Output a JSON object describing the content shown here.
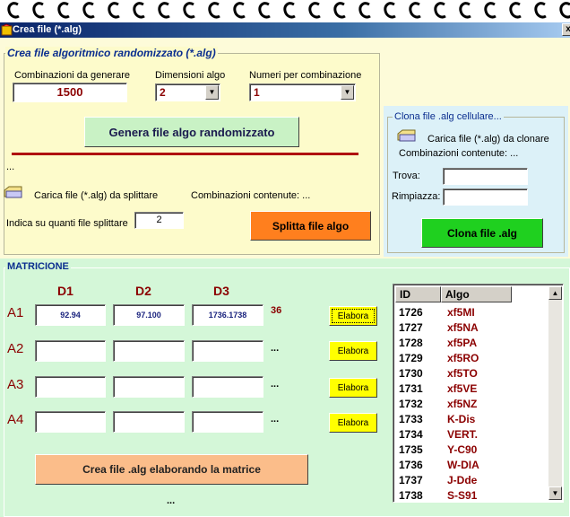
{
  "window": {
    "title": "Crea file (*.alg)",
    "close_glyph": "x"
  },
  "colors": {
    "title_bar": "#0a246a",
    "crea_panel": "#fdfbcb",
    "clona_panel": "#dcf1f8",
    "matrice_panel": "#d4f7d8",
    "accent_red": "#8b0000",
    "legend_blue": "#0b2e8f"
  },
  "crea": {
    "legend": "Crea file algoritmico randomizzato (*.alg)",
    "combinazioni_label": "Combinazioni da generare",
    "combinazioni_value": "1500",
    "dimensioni_label": "Dimensioni algo",
    "dimensioni_value": "2",
    "numeri_label": "Numeri per combinazione",
    "numeri_value": "1",
    "genera_button": "Genera file algo randomizzato",
    "status": "...",
    "carica_label": "Carica file (*.alg) da splittare",
    "combinazioni_contenute": "Combinazioni contenute: ...",
    "indica_label": "Indica su quanti file splittare",
    "split_value": "2",
    "splitta_button": "Splitta file algo"
  },
  "clona": {
    "legend": "Clona file .alg cellulare...",
    "carica_label": "Carica file (*.alg) da clonare",
    "combinazioni_contenute": "Combinazioni contenute: ...",
    "trova_label": "Trova:",
    "trova_value": "",
    "rimpiazza_label": "Rimpiazza:",
    "rimpiazza_value": "",
    "clona_button": "Clona file .alg"
  },
  "matrice": {
    "legend": "MATRICIONE",
    "headers": [
      "D1",
      "D2",
      "D3"
    ],
    "rows": [
      {
        "label": "A1",
        "cells": [
          "92.94",
          "97.100",
          "1736.1738"
        ],
        "result": "36",
        "button": "Elabora"
      },
      {
        "label": "A2",
        "cells": [
          "",
          "",
          ""
        ],
        "result": "...",
        "button": "Elabora"
      },
      {
        "label": "A3",
        "cells": [
          "",
          "",
          ""
        ],
        "result": "...",
        "button": "Elabora"
      },
      {
        "label": "A4",
        "cells": [
          "",
          "",
          ""
        ],
        "result": "...",
        "button": "Elabora"
      }
    ],
    "crea_button": "Crea file .alg elaborando la matrice",
    "status": "..."
  },
  "list": {
    "columns": [
      "ID",
      "Algo"
    ],
    "rows": [
      {
        "id": "1726",
        "algo": "xf5MI"
      },
      {
        "id": "1727",
        "algo": "xf5NA"
      },
      {
        "id": "1728",
        "algo": "xf5PA"
      },
      {
        "id": "1729",
        "algo": "xf5RO"
      },
      {
        "id": "1730",
        "algo": "xf5TO"
      },
      {
        "id": "1731",
        "algo": "xf5VE"
      },
      {
        "id": "1732",
        "algo": "xf5NZ"
      },
      {
        "id": "1733",
        "algo": "K-Dis"
      },
      {
        "id": "1734",
        "algo": "VERT."
      },
      {
        "id": "1735",
        "algo": "Y-C90"
      },
      {
        "id": "1736",
        "algo": "W-DIA"
      },
      {
        "id": "1737",
        "algo": "J-Dde"
      },
      {
        "id": "1738",
        "algo": "S-S91"
      }
    ]
  }
}
